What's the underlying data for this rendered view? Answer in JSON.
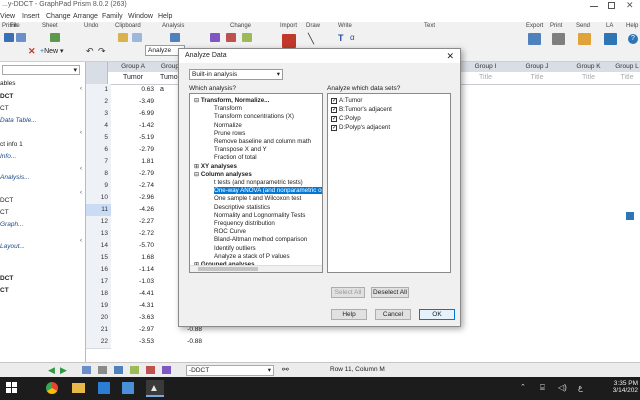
{
  "window": {
    "title": "...y-DDCT - GraphPad Prism 8.0.2 (263)"
  },
  "menu": [
    "View",
    "Insert",
    "Change",
    "Arrange",
    "Family",
    "Window",
    "Help"
  ],
  "ribbon_groups": [
    "Prism",
    "File",
    "Sheet",
    "Undo",
    "Clipboard",
    "Analysis",
    "Change",
    "Import",
    "Draw",
    "Write",
    "Text",
    "Export",
    "Print",
    "Send",
    "LA",
    "Help"
  ],
  "ribbon_misc": {
    "new_label": "New",
    "analyze_btn": "Analyze"
  },
  "nav": {
    "items": [
      "ables",
      "DCT",
      "CT",
      "Data Table...",
      "ct info 1",
      "Info...",
      "Analysis...",
      "DCT",
      "CT",
      "Graph...",
      "Layout...",
      "DCT",
      "CT"
    ]
  },
  "grid": {
    "col_groups": [
      "Group A",
      "Group B",
      "Group I",
      "Group J",
      "Group K",
      "Group L"
    ],
    "titles": [
      "Title",
      "Title",
      "Title",
      "Title"
    ],
    "col_a_header": "Tumor",
    "col_b_header": "Tumor's a",
    "rows": [
      "1",
      "2",
      "3",
      "4",
      "5",
      "6",
      "7",
      "8",
      "9",
      "10",
      "11",
      "12",
      "13",
      "14",
      "15",
      "16",
      "17",
      "18",
      "19",
      "20",
      "21",
      "22"
    ],
    "col_a": [
      "0.63",
      "-3.49",
      "-6.99",
      "-1.42",
      "-5.19",
      "-2.79",
      "1.81",
      "-2.79",
      "-2.74",
      "-2.96",
      "-4.26",
      "-2.27",
      "-2.72",
      "-5.70",
      "1.68",
      "-1.14",
      "-1.03",
      "-4.41",
      "-4.31",
      "-3.63",
      "-2.97",
      "-3.53"
    ],
    "col_b_tail": [
      "-0.88",
      "-0.88"
    ]
  },
  "dialog": {
    "title": "Analyze Data",
    "source_select": "Built-in analysis",
    "which_label": "Which analysis?",
    "datasets_label": "Analyze which data sets?",
    "tree": [
      {
        "t": "Transform, Normalize...",
        "b": true,
        "sign": "-",
        "lvl": 0
      },
      {
        "t": "Transform",
        "lvl": 1
      },
      {
        "t": "Transform concentrations (X)",
        "lvl": 1
      },
      {
        "t": "Normalize",
        "lvl": 1
      },
      {
        "t": "Prune rows",
        "lvl": 1
      },
      {
        "t": "Remove baseline and column math",
        "lvl": 1
      },
      {
        "t": "Transpose X and Y",
        "lvl": 1
      },
      {
        "t": "Fraction of total",
        "lvl": 1
      },
      {
        "t": "XY analyses",
        "b": true,
        "sign": "+",
        "lvl": 0
      },
      {
        "t": "Column analyses",
        "b": true,
        "sign": "-",
        "lvl": 0
      },
      {
        "t": "t tests (and nonparametric tests)",
        "lvl": 1
      },
      {
        "t": "One-way ANOVA (and nonparametric or",
        "lvl": 1,
        "sel": true
      },
      {
        "t": "One sample t and Wilcoxon test",
        "lvl": 1
      },
      {
        "t": "Descriptive statistics",
        "lvl": 1
      },
      {
        "t": "Normality and Lognormality Tests",
        "lvl": 1
      },
      {
        "t": "Frequency distribution",
        "lvl": 1
      },
      {
        "t": "ROC Curve",
        "lvl": 1
      },
      {
        "t": "Bland-Altman method comparison",
        "lvl": 1
      },
      {
        "t": "Identify outliers",
        "lvl": 1
      },
      {
        "t": "Analyze a stack of P values",
        "lvl": 1
      },
      {
        "t": "Grouped analyses",
        "b": true,
        "sign": "+",
        "lvl": 0
      }
    ],
    "datasets": [
      "A:Tumor",
      "B:Tumor's adjacent",
      "C:Polyp",
      "D:Polyp's adjacent"
    ],
    "select_all": "Select All",
    "deselect_all": "Deselect All",
    "help": "Help",
    "cancel": "Cancel",
    "ok": "OK"
  },
  "status": {
    "sheet": "-DDCT",
    "position": "Row 11, Column M"
  },
  "taskbar": {
    "time": "3:35 PM",
    "date": "3/14/202"
  }
}
